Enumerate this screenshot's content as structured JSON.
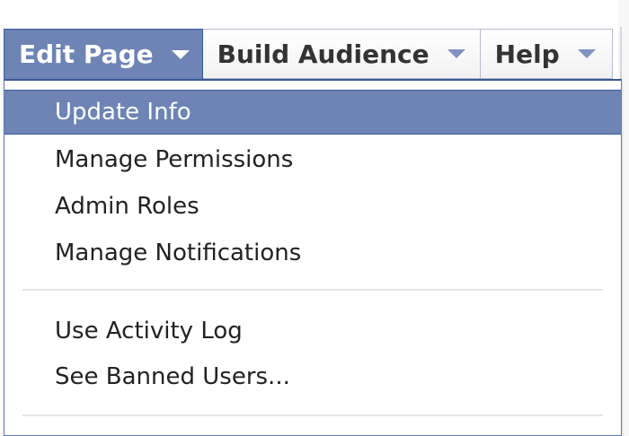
{
  "tabs": {
    "edit_page": "Edit Page",
    "build_audience": "Build Audience",
    "help": "Help"
  },
  "menu": {
    "items": [
      "Update Info",
      "Manage Permissions",
      "Admin Roles",
      "Manage Notifications",
      "Use Activity Log",
      "See Banned Users..."
    ],
    "highlighted_item": "Update Info"
  },
  "colors": {
    "active_tab": "#6d84b4",
    "highlight": "#6d84b4",
    "border": "#3b5998",
    "caret": "#7f92c1"
  },
  "icons": {
    "dropdown_caret": "chevron-down-icon"
  }
}
